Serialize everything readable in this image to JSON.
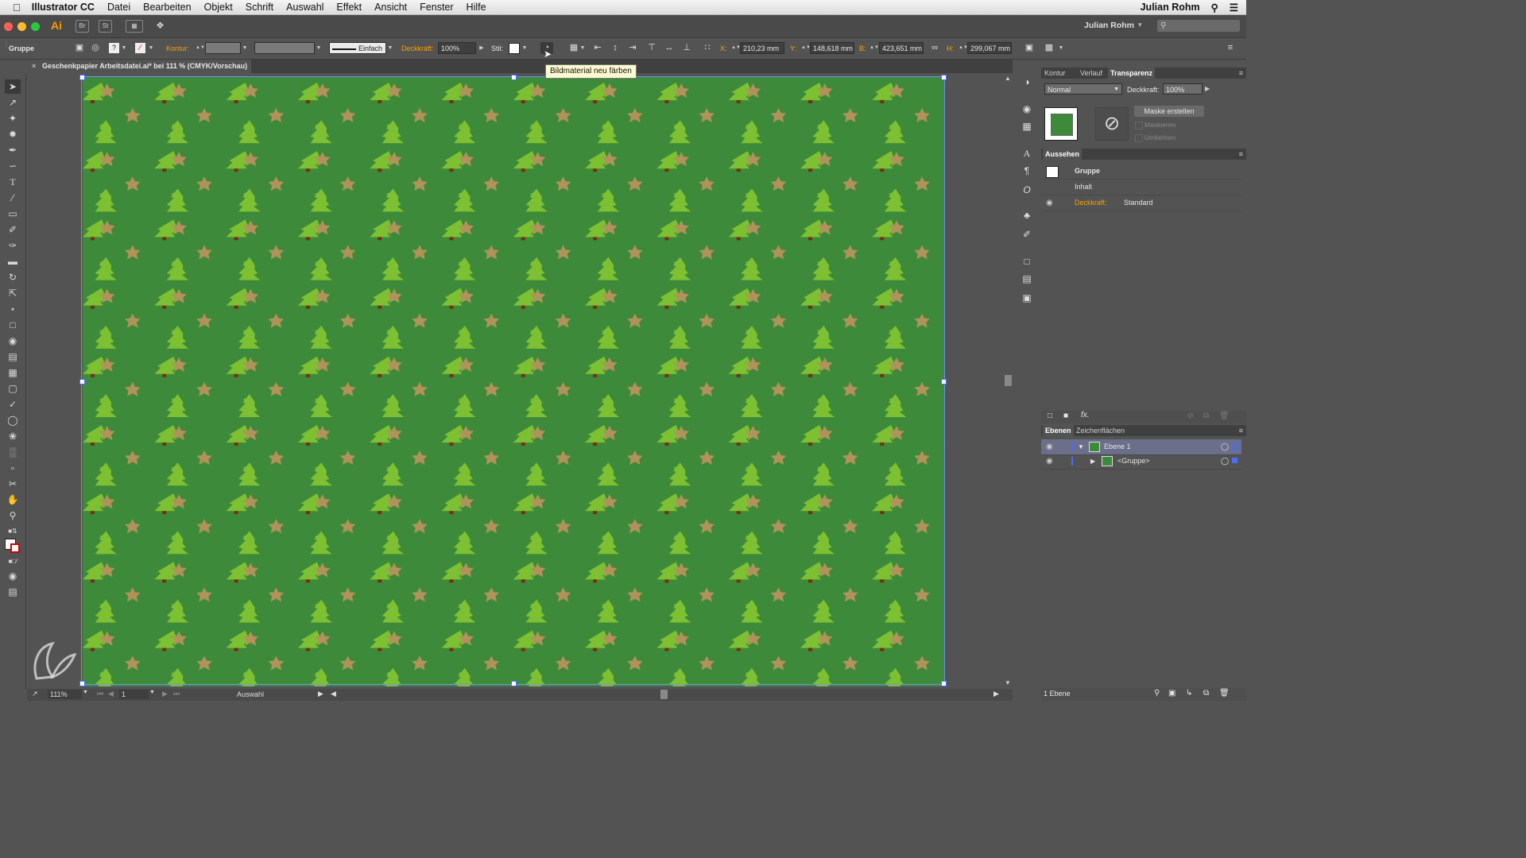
{
  "menubar": {
    "apple": "",
    "app_name": "Illustrator CC",
    "items": [
      "Datei",
      "Bearbeiten",
      "Objekt",
      "Schrift",
      "Auswahl",
      "Effekt",
      "Ansicht",
      "Fenster",
      "Hilfe"
    ],
    "user": "Julian Rohm"
  },
  "appbar": {
    "logo": "Ai",
    "br": "Br",
    "st": "St",
    "user": "Julian Rohm",
    "search_placeholder": "",
    "colors": {
      "close": "#ff5f57",
      "minimize": "#ffbd2e",
      "maximize": "#28c940"
    }
  },
  "control_bar": {
    "selection_type": "Gruppe",
    "kontur_label": "Kontur:",
    "stroke_style": "Einfach",
    "deckkraft_label": "Deckkraft:",
    "deckkraft_value": "100%",
    "stil_label": "Stil:",
    "x_label": "X:",
    "x_value": "210,23 mm",
    "y_label": "Y:",
    "y_value": "148,618 mm",
    "b_label": "B:",
    "b_value": "423,651 mm",
    "h_label": "H:",
    "h_value": "299,067 mm"
  },
  "tooltip": "Bildmaterial neu färben",
  "document": {
    "tab_title": "Geschenkpapier Arbeitsdatei.ai* bei 111 % (CMYK/Vorschau)",
    "pattern": {
      "background": "#3d8a3a",
      "tree_color": "#7dc132",
      "trunk_color": "#7a2c10",
      "star_color": "#b0925a"
    }
  },
  "status_bar": {
    "zoom": "111%",
    "artboard": "1",
    "tool_info": "Auswahl"
  },
  "transparency_panel": {
    "tabs": [
      "Kontur",
      "Verlauf",
      "Transparenz"
    ],
    "blend_mode": "Normal",
    "deckkraft_label": "Deckkraft:",
    "deckkraft_value": "100%",
    "mask_button": "Maske erstellen",
    "clip_label": "Maskieren",
    "invert_label": "Umkehren"
  },
  "appearance_panel": {
    "title": "Aussehen",
    "object": "Gruppe",
    "content": "Inhalt",
    "opacity_label": "Deckkraft:",
    "opacity_value": "Standard"
  },
  "layers_panel": {
    "tabs": [
      "Ebenen",
      "Zeichenflächen"
    ],
    "layers": [
      {
        "name": "Ebene 1",
        "level": 0
      },
      {
        "name": "<Gruppe>",
        "level": 1
      }
    ],
    "footer": "1 Ebene"
  }
}
